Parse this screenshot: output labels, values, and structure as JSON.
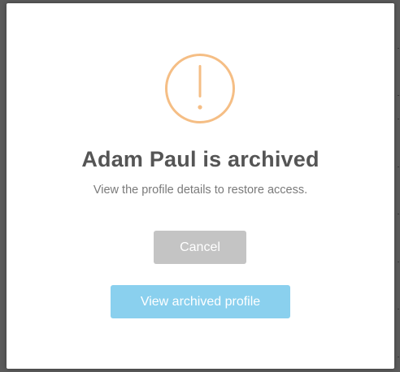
{
  "dialog": {
    "icon": "exclamation-circle-icon",
    "icon_color": "#f5be85",
    "title": "Adam Paul is archived",
    "message": "View the profile details to restore access.",
    "cancel_label": "Cancel",
    "primary_label": "View archived profile",
    "cancel_color": "#c4c4c4",
    "primary_color": "#8ad0ee"
  }
}
